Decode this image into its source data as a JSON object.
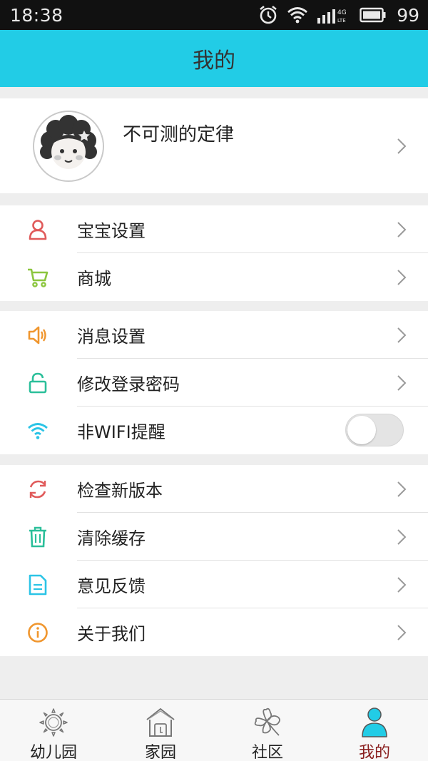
{
  "status_bar": {
    "time": "18:38",
    "network": "4G",
    "battery": "99"
  },
  "header": {
    "title": "我的"
  },
  "profile": {
    "name": "不可测的定律"
  },
  "groups": [
    {
      "items": [
        {
          "label": "宝宝设置",
          "icon": "person-icon",
          "color": "#e05a5a"
        },
        {
          "label": "商城",
          "icon": "cart-icon",
          "color": "#8cc63f"
        }
      ]
    },
    {
      "items": [
        {
          "label": "消息设置",
          "icon": "speaker-icon",
          "color": "#f0962e"
        },
        {
          "label": "修改登录密码",
          "icon": "lock-icon",
          "color": "#2bbf9a"
        },
        {
          "label": "非WIFI提醒",
          "icon": "wifi-icon",
          "color": "#2bc4e6",
          "toggle": false
        }
      ]
    },
    {
      "items": [
        {
          "label": "检查新版本",
          "icon": "refresh-icon",
          "color": "#e05a5a"
        },
        {
          "label": "清除缓存",
          "icon": "trash-icon",
          "color": "#2bbf9a"
        },
        {
          "label": "意见反馈",
          "icon": "document-icon",
          "color": "#2bc4e6"
        },
        {
          "label": "关于我们",
          "icon": "info-icon",
          "color": "#f0962e"
        }
      ]
    }
  ],
  "tabs": [
    {
      "label": "幼儿园",
      "icon": "sun-icon",
      "active": false
    },
    {
      "label": "家园",
      "icon": "house-icon",
      "active": false
    },
    {
      "label": "社区",
      "icon": "clover-icon",
      "active": false
    },
    {
      "label": "我的",
      "icon": "user-icon",
      "active": true
    }
  ],
  "colors": {
    "accent": "#22cce6",
    "active_tab_label": "#8a1f1f",
    "background": "#eeeeee"
  }
}
